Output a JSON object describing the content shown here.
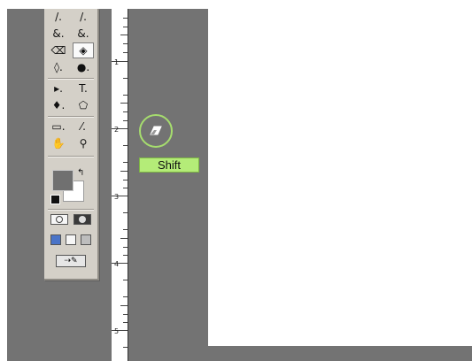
{
  "toolbox": {
    "rows": [
      {
        "left": {
          "name": "brush-icon",
          "glyph": "/."
        },
        "right": {
          "name": "pencil-icon",
          "glyph": "/."
        }
      },
      {
        "left": {
          "name": "clone-stamp-icon",
          "glyph": "&."
        },
        "right": {
          "name": "history-brush-icon",
          "glyph": "&."
        }
      },
      {
        "left": {
          "name": "eraser-icon",
          "glyph": "⌫"
        },
        "right": {
          "name": "paint-bucket-icon",
          "glyph": "◈"
        }
      },
      {
        "left": {
          "name": "blur-icon",
          "glyph": "◊."
        },
        "right": {
          "name": "dodge-icon",
          "glyph": "●."
        }
      },
      {
        "left": {
          "name": "path-selection-icon",
          "glyph": "▸."
        },
        "right": {
          "name": "type-tool-icon",
          "glyph": "T."
        }
      },
      {
        "left": {
          "name": "pen-tool-icon",
          "glyph": "♦."
        },
        "right": {
          "name": "custom-shape-icon",
          "glyph": "⬠"
        }
      },
      {
        "left": {
          "name": "notes-icon",
          "glyph": "▭."
        },
        "right": {
          "name": "eyedropper-icon",
          "glyph": "⁄."
        }
      },
      {
        "left": {
          "name": "hand-tool-icon",
          "glyph": "✋"
        },
        "right": {
          "name": "zoom-tool-icon",
          "glyph": "⚲"
        }
      }
    ],
    "colors": {
      "foreground": "#707070",
      "background": "#ffffff"
    }
  },
  "ruler": {
    "labels": [
      "1",
      "2",
      "3",
      "4",
      "5"
    ]
  },
  "shortcut_hint": {
    "key_label": "Shift",
    "icon": "eraser-icon"
  }
}
